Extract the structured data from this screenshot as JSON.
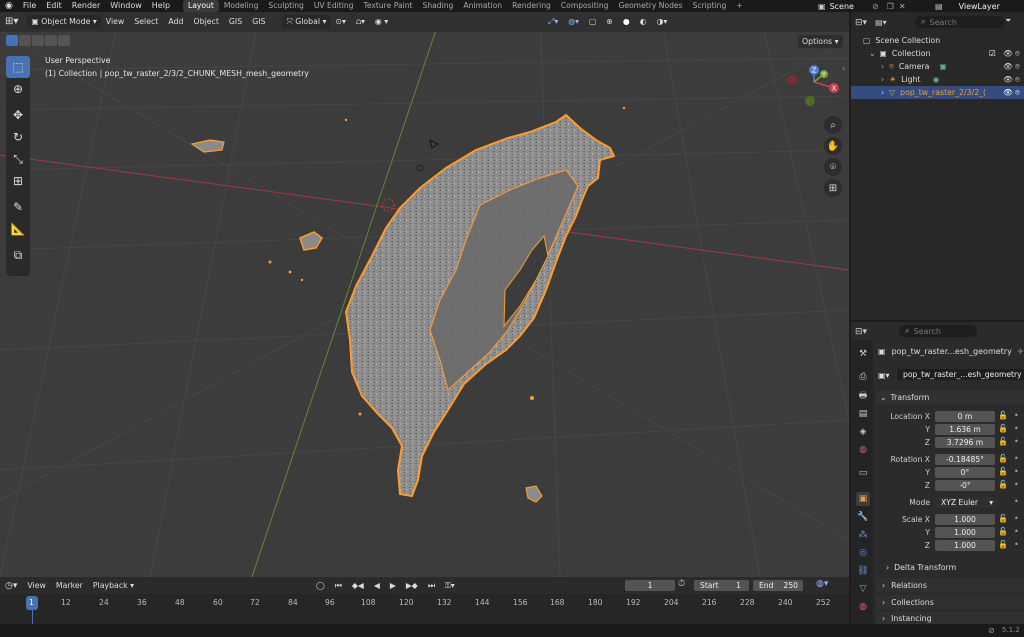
{
  "topbar": {
    "menus": [
      "File",
      "Edit",
      "Render",
      "Window",
      "Help"
    ],
    "workspaces": [
      "Layout",
      "Modeling",
      "Sculpting",
      "UV Editing",
      "Texture Paint",
      "Shading",
      "Animation",
      "Rendering",
      "Compositing",
      "Geometry Nodes",
      "Scripting"
    ],
    "active_workspace": "Layout",
    "add_tab": "+",
    "scene_name": "Scene",
    "view_layer": "ViewLayer"
  },
  "viewport_header": {
    "mode": "Object Mode",
    "menus": [
      "View",
      "Select",
      "Add",
      "Object",
      "GIS",
      "GIS"
    ],
    "orientation": "Global",
    "options": "Options"
  },
  "viewport": {
    "perspective": "User Perspective",
    "collection_info": "(1) Collection | pop_tw_raster_2/3/2_CHUNK_MESH_mesh_geometry",
    "gizmo": {
      "x": "X",
      "y": "Y",
      "z": "Z"
    }
  },
  "timeline": {
    "menus": [
      "View",
      "Marker",
      "Playback"
    ],
    "current_frame": "1",
    "start_label": "Start",
    "start": "1",
    "end_label": "End",
    "end": "250",
    "ruler": [
      "1",
      "12",
      "24",
      "36",
      "48",
      "60",
      "72",
      "84",
      "96",
      "108",
      "120",
      "132",
      "144",
      "156",
      "168",
      "180",
      "192",
      "204",
      "216",
      "228",
      "240",
      "252"
    ]
  },
  "statusbar": {
    "version": "5.1.2"
  },
  "outliner": {
    "search_placeholder": "Search",
    "scene_collection": "Scene Collection",
    "collection": "Collection",
    "items": [
      {
        "name": "Camera"
      },
      {
        "name": "Light"
      },
      {
        "name": "pop_tw_raster_2/3/2_("
      }
    ]
  },
  "properties": {
    "search_placeholder": "Search",
    "object_name_header": "pop_tw_raster...esh_geometry",
    "object_name_field": "pop_tw_raster_...esh_geometry",
    "transform": "Transform",
    "location_label": "Location X",
    "location": [
      "0 m",
      "1.636 m",
      "3.7296 m"
    ],
    "rotation_label": "Rotation X",
    "rotation": [
      "-0.18485°",
      "0°",
      "-0°"
    ],
    "axis_y": "Y",
    "axis_z": "Z",
    "mode_label": "Mode",
    "mode": "XYZ Euler",
    "scale_label": "Scale X",
    "scale": [
      "1.000",
      "1.000",
      "1.000"
    ],
    "delta_transform": "Delta Transform",
    "relations": "Relations",
    "collections": "Collections",
    "instancing": "Instancing"
  },
  "colors": {
    "accent": "#4772b3",
    "selection_outline": "#ff9b2d",
    "axis_x": "#c8414d",
    "axis_y": "#7da33a"
  }
}
